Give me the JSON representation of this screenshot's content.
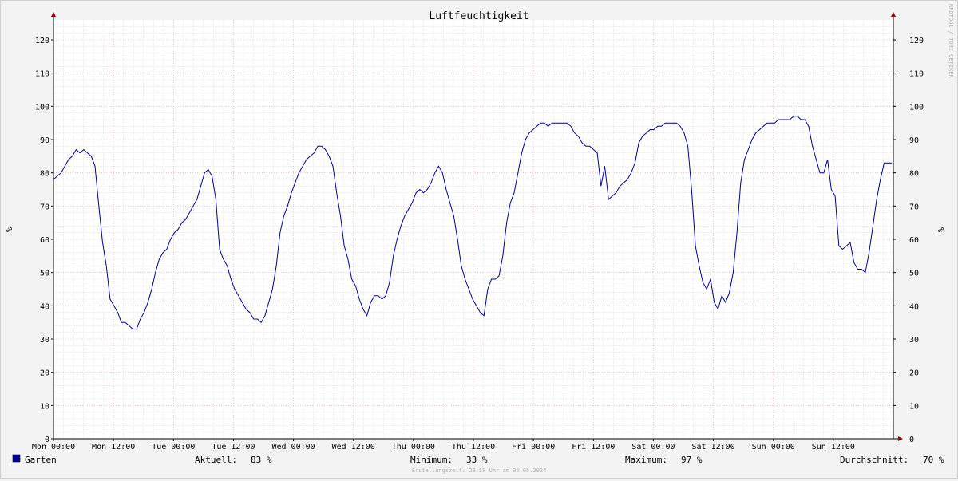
{
  "chart_data": {
    "type": "line",
    "title": "Luftfeuchtigkeit",
    "ylabel": "%",
    "ylabel_right": "%",
    "ylim": [
      0,
      126
    ],
    "y_ticks": [
      0,
      10,
      20,
      30,
      40,
      50,
      60,
      70,
      80,
      90,
      100,
      110,
      120
    ],
    "x_ticks": [
      "Mon 00:00",
      "Mon 12:00",
      "Tue 00:00",
      "Tue 12:00",
      "Wed 00:00",
      "Wed 12:00",
      "Thu 00:00",
      "Thu 12:00",
      "Fri 00:00",
      "Fri 12:00",
      "Sat 00:00",
      "Sat 12:00",
      "Sun 00:00",
      "Sun 12:00"
    ],
    "x_unit": "hours since Mon 00:00",
    "xlim": [
      0,
      168
    ],
    "grid": true,
    "watermark": "RRDTOOL / TOBI OETIKER",
    "series": [
      {
        "name": "Garten",
        "color": "#000099",
        "points": [
          [
            0,
            78
          ],
          [
            1,
            79
          ],
          [
            2,
            80
          ],
          [
            3,
            82
          ],
          [
            4,
            84
          ],
          [
            5,
            85
          ],
          [
            6,
            87
          ],
          [
            7,
            86
          ],
          [
            8,
            87
          ],
          [
            9,
            86
          ],
          [
            10,
            85
          ],
          [
            11,
            82
          ],
          [
            12,
            70
          ],
          [
            13,
            59
          ],
          [
            14,
            52
          ],
          [
            15,
            42
          ],
          [
            16,
            40
          ],
          [
            17,
            38
          ],
          [
            18,
            35
          ],
          [
            19,
            35
          ],
          [
            20,
            34
          ],
          [
            21,
            33
          ],
          [
            22,
            33
          ],
          [
            23,
            36
          ],
          [
            24,
            38
          ],
          [
            25,
            41
          ],
          [
            26,
            45
          ],
          [
            27,
            50
          ],
          [
            28,
            54
          ],
          [
            29,
            56
          ],
          [
            30,
            57
          ],
          [
            31,
            60
          ],
          [
            32,
            62
          ],
          [
            33,
            63
          ],
          [
            34,
            65
          ],
          [
            35,
            66
          ],
          [
            36,
            68
          ],
          [
            37,
            70
          ],
          [
            38,
            72
          ],
          [
            39,
            76
          ],
          [
            40,
            80
          ],
          [
            41,
            81
          ],
          [
            42,
            79
          ],
          [
            43,
            72
          ],
          [
            44,
            57
          ],
          [
            45,
            54
          ],
          [
            46,
            52
          ],
          [
            47,
            48
          ],
          [
            48,
            45
          ],
          [
            49,
            43
          ],
          [
            50,
            41
          ],
          [
            51,
            39
          ],
          [
            52,
            38
          ],
          [
            53,
            36
          ],
          [
            54,
            36
          ],
          [
            55,
            35
          ],
          [
            56,
            37
          ],
          [
            57,
            41
          ],
          [
            58,
            45
          ],
          [
            59,
            52
          ],
          [
            60,
            62
          ],
          [
            61,
            67
          ],
          [
            62,
            70
          ],
          [
            63,
            74
          ],
          [
            64,
            77
          ],
          [
            65,
            80
          ],
          [
            66,
            82
          ],
          [
            67,
            84
          ],
          [
            68,
            85
          ],
          [
            69,
            86
          ],
          [
            70,
            88
          ],
          [
            71,
            88
          ],
          [
            72,
            87
          ],
          [
            73,
            85
          ],
          [
            74,
            82
          ],
          [
            75,
            74
          ],
          [
            76,
            67
          ],
          [
            77,
            58
          ],
          [
            78,
            54
          ],
          [
            79,
            48
          ],
          [
            80,
            46
          ],
          [
            81,
            42
          ],
          [
            82,
            39
          ],
          [
            83,
            37
          ],
          [
            84,
            41
          ],
          [
            85,
            43
          ],
          [
            86,
            43
          ],
          [
            87,
            42
          ],
          [
            88,
            43
          ],
          [
            89,
            47
          ],
          [
            90,
            55
          ],
          [
            91,
            60
          ],
          [
            92,
            64
          ],
          [
            93,
            67
          ],
          [
            94,
            69
          ],
          [
            95,
            71
          ],
          [
            96,
            74
          ],
          [
            97,
            75
          ],
          [
            98,
            74
          ],
          [
            99,
            75
          ],
          [
            100,
            77
          ],
          [
            101,
            80
          ],
          [
            102,
            82
          ],
          [
            103,
            80
          ],
          [
            104,
            75
          ],
          [
            105,
            71
          ],
          [
            106,
            67
          ],
          [
            107,
            60
          ],
          [
            108,
            52
          ],
          [
            109,
            48
          ],
          [
            110,
            45
          ],
          [
            111,
            42
          ],
          [
            112,
            40
          ],
          [
            113,
            38
          ],
          [
            114,
            37
          ],
          [
            115,
            45
          ],
          [
            116,
            48
          ],
          [
            117,
            48
          ],
          [
            118,
            49
          ],
          [
            119,
            55
          ],
          [
            120,
            65
          ],
          [
            121,
            71
          ],
          [
            122,
            74
          ],
          [
            123,
            80
          ],
          [
            124,
            86
          ],
          [
            125,
            90
          ],
          [
            126,
            92
          ],
          [
            127,
            93
          ],
          [
            128,
            94
          ],
          [
            129,
            95
          ],
          [
            130,
            95
          ],
          [
            131,
            94
          ],
          [
            132,
            95
          ],
          [
            133,
            95
          ],
          [
            134,
            95
          ],
          [
            135,
            95
          ],
          [
            136,
            95
          ],
          [
            137,
            94
          ],
          [
            138,
            92
          ],
          [
            139,
            91
          ],
          [
            140,
            89
          ],
          [
            141,
            88
          ],
          [
            142,
            88
          ],
          [
            143,
            87
          ],
          [
            144,
            86
          ],
          [
            145,
            76
          ],
          [
            146,
            82
          ],
          [
            147,
            72
          ],
          [
            148,
            73
          ],
          [
            149,
            74
          ],
          [
            150,
            76
          ],
          [
            151,
            77
          ],
          [
            152,
            78
          ],
          [
            153,
            80
          ],
          [
            154,
            83
          ],
          [
            155,
            89
          ],
          [
            156,
            91
          ],
          [
            157,
            92
          ],
          [
            158,
            93
          ],
          [
            159,
            93
          ],
          [
            160,
            94
          ],
          [
            161,
            94
          ],
          [
            162,
            95
          ],
          [
            163,
            95
          ],
          [
            164,
            95
          ],
          [
            165,
            95
          ],
          [
            166,
            94
          ],
          [
            167,
            92
          ],
          [
            168,
            88
          ],
          [
            169,
            75
          ],
          [
            170,
            58
          ],
          [
            171,
            52
          ],
          [
            172,
            47
          ],
          [
            173,
            45
          ],
          [
            174,
            48
          ],
          [
            175,
            41
          ],
          [
            176,
            39
          ],
          [
            177,
            43
          ],
          [
            178,
            41
          ],
          [
            179,
            44
          ],
          [
            180,
            50
          ],
          [
            181,
            62
          ],
          [
            182,
            77
          ],
          [
            183,
            84
          ],
          [
            184,
            87
          ],
          [
            185,
            90
          ],
          [
            186,
            92
          ],
          [
            187,
            93
          ],
          [
            188,
            94
          ],
          [
            189,
            95
          ],
          [
            190,
            95
          ],
          [
            191,
            95
          ],
          [
            192,
            96
          ],
          [
            193,
            96
          ],
          [
            194,
            96
          ],
          [
            195,
            96
          ],
          [
            196,
            97
          ],
          [
            197,
            97
          ],
          [
            198,
            96
          ],
          [
            199,
            96
          ],
          [
            200,
            94
          ],
          [
            201,
            88
          ],
          [
            202,
            84
          ],
          [
            203,
            80
          ],
          [
            204,
            80
          ],
          [
            205,
            84
          ],
          [
            206,
            75
          ],
          [
            207,
            73
          ],
          [
            208,
            58
          ],
          [
            209,
            57
          ],
          [
            210,
            58
          ],
          [
            211,
            59
          ],
          [
            212,
            53
          ],
          [
            213,
            51
          ],
          [
            214,
            51
          ],
          [
            215,
            50
          ],
          [
            216,
            56
          ],
          [
            217,
            64
          ],
          [
            218,
            72
          ],
          [
            219,
            78
          ],
          [
            220,
            83
          ],
          [
            221,
            83
          ],
          [
            222,
            83
          ]
        ]
      }
    ],
    "legend": {
      "series_label": "Garten",
      "current_label": "Aktuell:",
      "current_value": "83 %",
      "min_label": "Minimum:",
      "min_value": "33 %",
      "max_label": "Maximum:",
      "max_value": "97 %",
      "avg_label": "Durchschnitt:",
      "avg_value": "70 %"
    },
    "footer": "Erstellungszeit: 23:58 Uhr am 05.05.2024"
  }
}
